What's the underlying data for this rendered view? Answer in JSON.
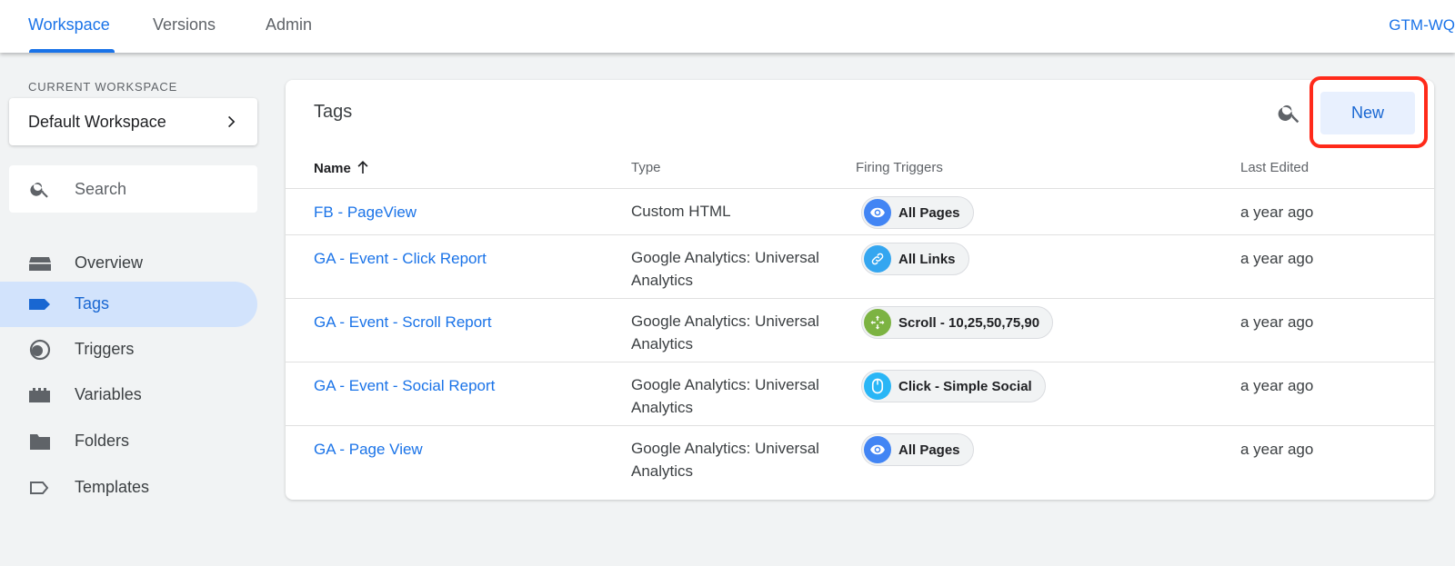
{
  "topbar": {
    "tabs": [
      {
        "label": "Workspace",
        "active": true
      },
      {
        "label": "Versions",
        "active": false
      },
      {
        "label": "Admin",
        "active": false
      }
    ],
    "container_id": "GTM-WQ"
  },
  "sidebar": {
    "current_workspace_label": "CURRENT WORKSPACE",
    "workspace_name": "Default Workspace",
    "search_placeholder": "Search",
    "items": [
      {
        "label": "Overview",
        "icon": "overview-icon",
        "active": false
      },
      {
        "label": "Tags",
        "icon": "tag-icon",
        "active": true
      },
      {
        "label": "Triggers",
        "icon": "trigger-icon",
        "active": false
      },
      {
        "label": "Variables",
        "icon": "variables-icon",
        "active": false
      },
      {
        "label": "Folders",
        "icon": "folder-icon",
        "active": false
      },
      {
        "label": "Templates",
        "icon": "template-icon",
        "active": false
      }
    ]
  },
  "main": {
    "title": "Tags",
    "new_button_label": "New",
    "columns": {
      "name": "Name",
      "type": "Type",
      "triggers": "Firing Triggers",
      "last_edited": "Last Edited"
    },
    "rows": [
      {
        "name": "FB - PageView",
        "type": "Custom HTML",
        "trigger": "All Pages",
        "trigger_icon": "eye-icon",
        "trigger_color": "#4285f4",
        "last_edited": "a year ago"
      },
      {
        "name": "GA - Event - Click Report",
        "type": "Google Analytics: Universal Analytics",
        "trigger": "All Links",
        "trigger_icon": "link-icon",
        "trigger_color": "#34a6f0",
        "last_edited": "a year ago"
      },
      {
        "name": "GA - Event - Scroll Report",
        "type": "Google Analytics: Universal Analytics",
        "trigger": "Scroll - 10,25,50,75,90",
        "trigger_icon": "scroll-icon",
        "trigger_color": "#7cb342",
        "last_edited": "a year ago"
      },
      {
        "name": "GA - Event - Social Report",
        "type": "Google Analytics: Universal Analytics",
        "trigger": "Click - Simple Social",
        "trigger_icon": "mouse-icon",
        "trigger_color": "#29b6f6",
        "last_edited": "a year ago"
      },
      {
        "name": "GA - Page View",
        "type": "Google Analytics: Universal Analytics",
        "trigger": "All Pages",
        "trigger_icon": "eye-icon",
        "trigger_color": "#4285f4",
        "last_edited": "a year ago"
      }
    ]
  },
  "colors": {
    "accent": "#1a73e8",
    "highlight": "#ff2a1a"
  }
}
